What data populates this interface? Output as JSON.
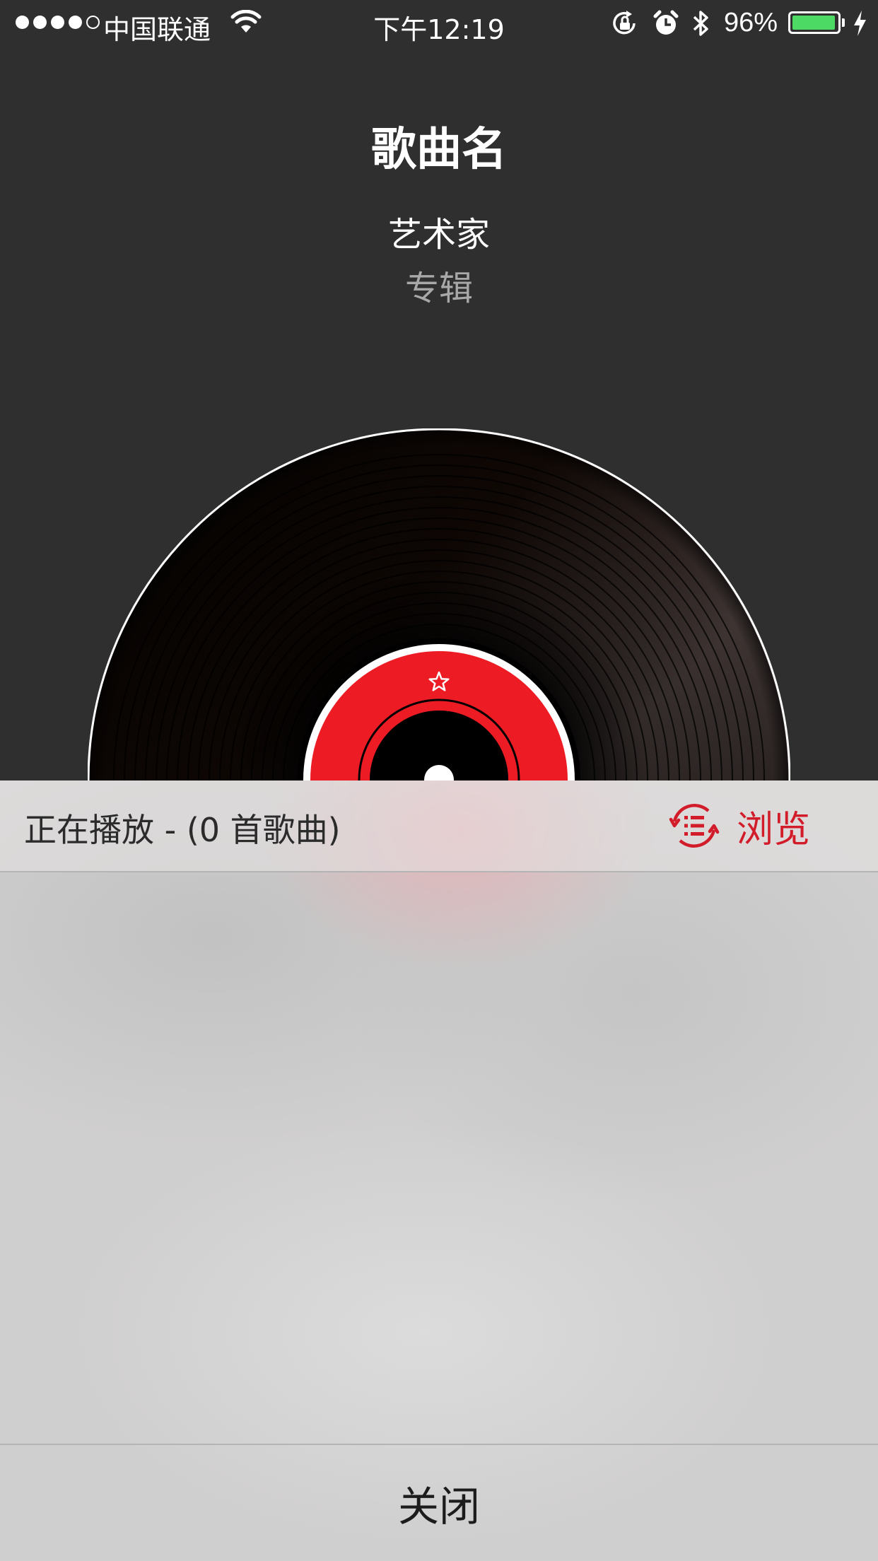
{
  "status_bar": {
    "carrier": "中国联通",
    "time": "下午12:19",
    "battery_percent": "96%",
    "battery_level": 0.96,
    "signal_bars": 4,
    "signal_max": 5,
    "battery_color": "#4cd964"
  },
  "now_playing": {
    "title": "歌曲名",
    "artist": "艺术家",
    "album": "专辑"
  },
  "queue": {
    "header_label": "正在播放 - (0 首歌曲)",
    "browse_label": "浏览",
    "accent_color": "#d21c2a"
  },
  "footer": {
    "close_label": "关闭"
  },
  "icons": {
    "wifi": "wifi-icon",
    "rotation_lock": "rotation-lock-icon",
    "alarm": "alarm-icon",
    "bluetooth": "bluetooth-icon",
    "charging": "charging-bolt-icon",
    "browse": "browse-list-icon",
    "vinyl_star": "star-icon"
  }
}
